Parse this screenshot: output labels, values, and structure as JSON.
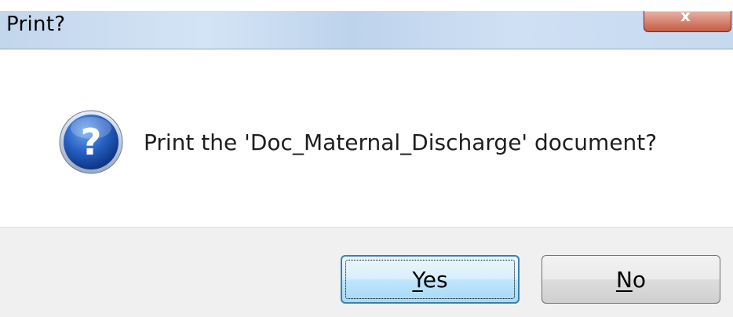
{
  "window": {
    "title": "Print?",
    "close_symbol": "x"
  },
  "dialog": {
    "icon": "question-icon",
    "message": "Print the 'Doc_Maternal_Discharge' document?"
  },
  "buttons": {
    "yes": {
      "accel": "Y",
      "rest": "es"
    },
    "no": {
      "accel": "N",
      "rest": "o"
    }
  },
  "colors": {
    "title_gradient": "#c2d6ec",
    "close_button": "#c65a43",
    "footer_bg": "#f0f0f0",
    "default_button_border": "#3c7fb1"
  }
}
